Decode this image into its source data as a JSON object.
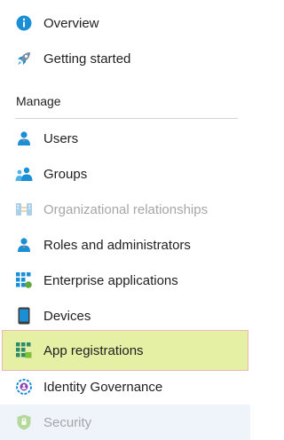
{
  "nav": {
    "top_items": [
      {
        "label": "Overview",
        "icon": "info-icon"
      },
      {
        "label": "Getting started",
        "icon": "rocket-icon"
      }
    ],
    "section_header": "Manage",
    "manage_items": [
      {
        "label": "Users",
        "icon": "user-icon",
        "state": "normal"
      },
      {
        "label": "Groups",
        "icon": "groups-icon",
        "state": "normal"
      },
      {
        "label": "Organizational relationships",
        "icon": "org-relationships-icon",
        "state": "disabled"
      },
      {
        "label": "Roles and administrators",
        "icon": "roles-icon",
        "state": "normal"
      },
      {
        "label": "Enterprise applications",
        "icon": "enterprise-apps-icon",
        "state": "normal"
      },
      {
        "label": "Devices",
        "icon": "device-icon",
        "state": "normal"
      },
      {
        "label": "App registrations",
        "icon": "app-registrations-icon",
        "state": "selected"
      },
      {
        "label": "Identity Governance",
        "icon": "identity-governance-icon",
        "state": "normal"
      },
      {
        "label": "Security",
        "icon": "shield-icon",
        "state": "disabled-hovered"
      }
    ]
  },
  "colors": {
    "accent_blue": "#1b8fd6",
    "selected_background": "#e6f0a5",
    "selected_border": "#f2b5b5",
    "disabled_text": "#a6a6a6"
  }
}
